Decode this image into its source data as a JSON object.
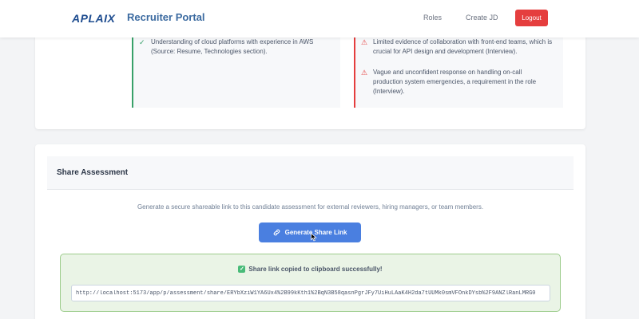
{
  "header": {
    "logo": "APLAIX",
    "brand": "Recruiter Portal",
    "nav": {
      "roles": "Roles",
      "create_jd": "Create JD"
    },
    "logout": "Logout"
  },
  "assessment": {
    "strengths": [
      {
        "icon": "check-icon",
        "text": "Understanding of cloud platforms with experience in AWS (Source: Resume, Technologies section)."
      }
    ],
    "concerns": [
      {
        "icon": "warning-icon",
        "text": "Limited evidence of collaboration with front-end teams, which is crucial for API design and development (Interview)."
      },
      {
        "icon": "warning-icon",
        "text": "Vague and unconfident response on handling on-call production system emergencies, a requirement in the role (Interview)."
      }
    ]
  },
  "share": {
    "title": "Share Assessment",
    "description": "Generate a secure shareable link to this candidate assessment for external reviewers, hiring managers, or team members.",
    "button_label": "Generate Share Link",
    "success_message": "Share link copied to clipboard successfully!",
    "link_value": "http://localhost:5173/app/p/assessment/share/ERYbXziW1YA6Ux4%2B99kKth1%2BqN3B58qasnPgrJFy7UiHuLAaK4H2da7tUUMk0smVFOnkDYsb%2F9ANZlRanLMRG0"
  },
  "colors": {
    "accent": "#4a7fe0",
    "logout": "#e53e3e",
    "success": "#38a169",
    "warning": "#e53e3e"
  }
}
